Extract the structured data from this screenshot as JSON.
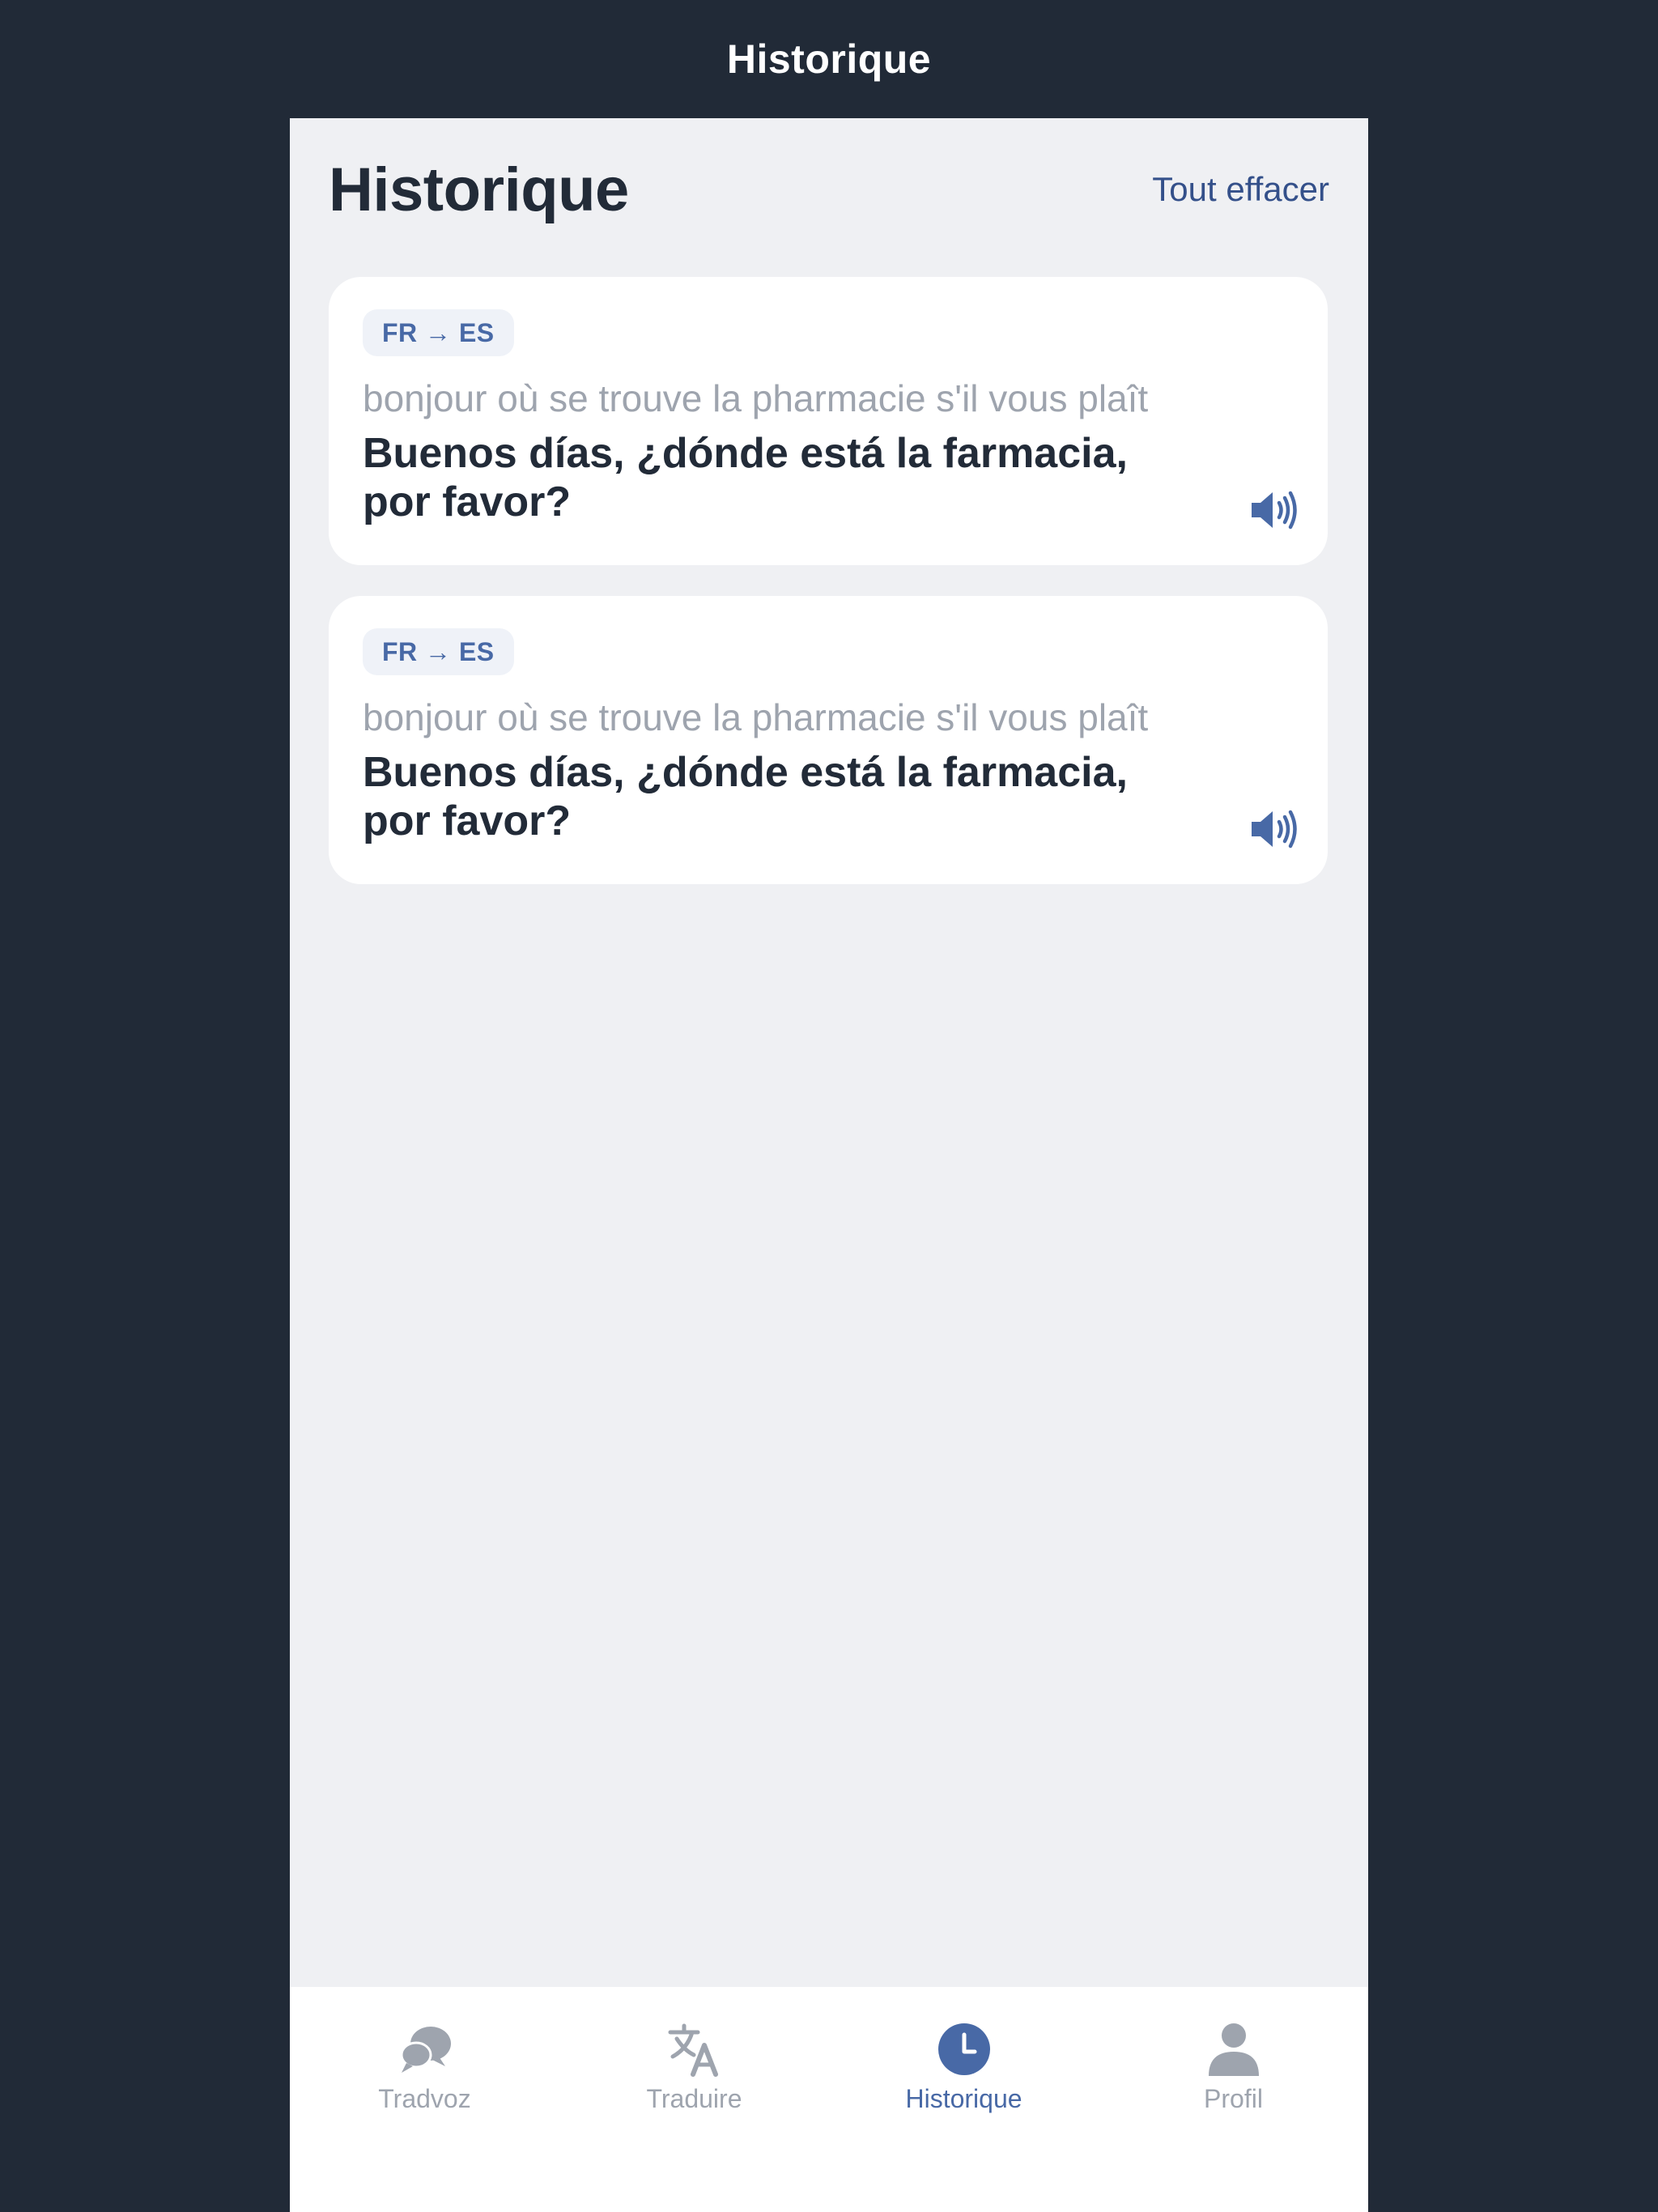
{
  "window": {
    "title": "Historique"
  },
  "header": {
    "title": "Historique",
    "clear_label": "Tout effacer"
  },
  "history": [
    {
      "lang_pair": "FR → ES",
      "source": "bonjour où se trouve la pharmacie s'il vous plaît",
      "translation": "Buenos días, ¿dónde está la farmacia, por favor?"
    },
    {
      "lang_pair": "FR → ES",
      "source": "bonjour où se trouve la pharmacie s'il vous plaît",
      "translation": "Buenos días, ¿dónde está la farmacia, por favor?"
    }
  ],
  "tabs": [
    {
      "label": "Tradvoz",
      "icon": "chat-bubbles-icon",
      "active": false
    },
    {
      "label": "Traduire",
      "icon": "translate-icon",
      "active": false
    },
    {
      "label": "Historique",
      "icon": "clock-icon",
      "active": true
    },
    {
      "label": "Profil",
      "icon": "person-icon",
      "active": false
    }
  ],
  "colors": {
    "frame_background": "#212a37",
    "app_background": "#eff0f3",
    "accent": "#4869a6",
    "clear_link": "#34508a",
    "text_primary": "#222b38",
    "text_secondary": "#9ea4ae",
    "badge_background": "#eff2f8"
  }
}
